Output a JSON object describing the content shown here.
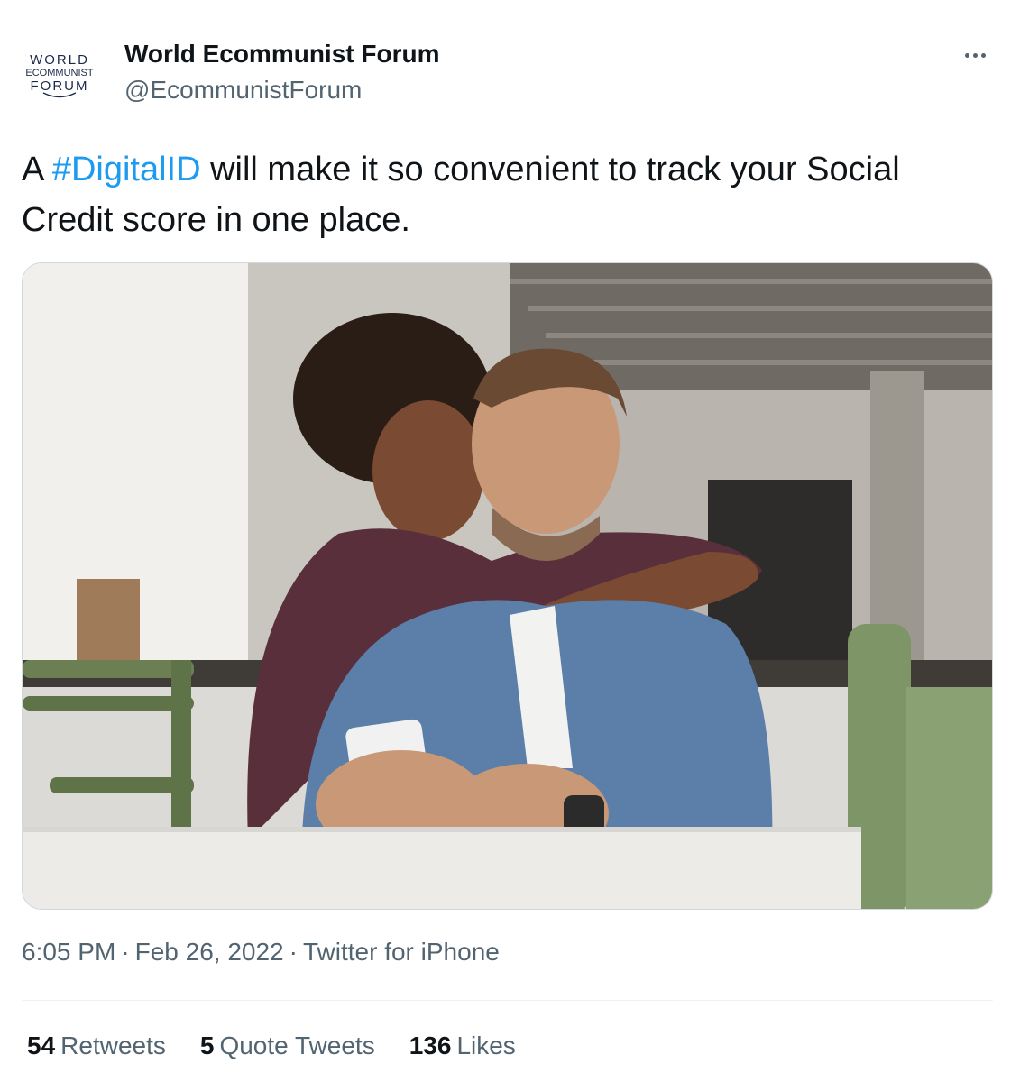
{
  "author": {
    "avatar_lines": [
      "WORLD",
      "ECOMMUNIST",
      "FORUM"
    ],
    "name": "World Ecommunist Forum",
    "handle": "@EcommunistForum"
  },
  "tweet": {
    "text_prefix": "A ",
    "hashtag": "#DigitalID",
    "text_suffix": " will make it so convenient to track your Social Credit score in one place."
  },
  "media": {
    "icon": "photo"
  },
  "meta": {
    "time": "6:05 PM",
    "date": "Feb 26, 2022",
    "separator": "·",
    "source": "Twitter for iPhone"
  },
  "stats": [
    {
      "count": "54",
      "label": "Retweets"
    },
    {
      "count": "5",
      "label": "Quote Tweets"
    },
    {
      "count": "136",
      "label": "Likes"
    }
  ],
  "colors": {
    "accent": "#1d9bf0",
    "text": "#0f1419",
    "secondary": "#536471"
  }
}
